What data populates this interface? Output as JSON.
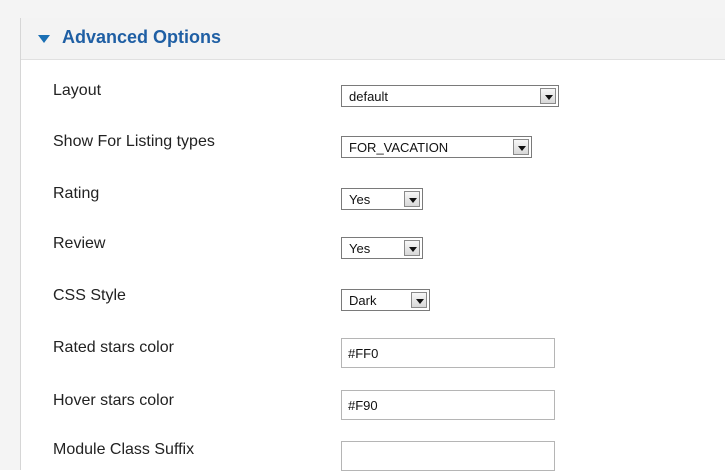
{
  "panel": {
    "title": "Advanced Options",
    "toggle_icon": "triangle-down-icon"
  },
  "fields": {
    "layout": {
      "label": "Layout",
      "value": "default"
    },
    "listing_types": {
      "label": "Show For Listing types",
      "value": "FOR_VACATION"
    },
    "rating": {
      "label": "Rating",
      "value": "Yes"
    },
    "review": {
      "label": "Review",
      "value": "Yes"
    },
    "css_style": {
      "label": "CSS Style",
      "value": "Dark"
    },
    "rated_stars_color": {
      "label": "Rated stars color",
      "value": "#FF0"
    },
    "hover_stars_color": {
      "label": "Hover stars color",
      "value": "#F90"
    },
    "module_class_suffix": {
      "label": "Module Class Suffix",
      "value": ""
    }
  },
  "colors": {
    "title": "#1f5fa4",
    "header_background": "#f3f3f3",
    "label_text": "#222222"
  }
}
